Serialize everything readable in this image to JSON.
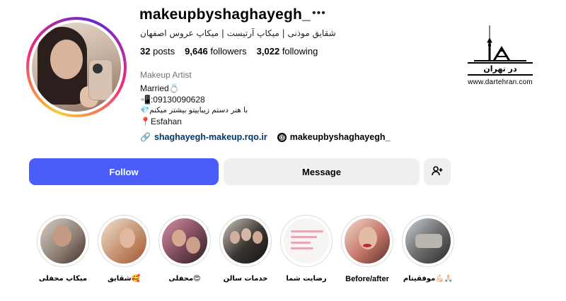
{
  "profile": {
    "username": "makeupbyshaghayegh_",
    "more_icon": "more-horizontal-icon",
    "fullname": "شقایق موذنی | میکاپ آرتیست | میکاپ عروس اصفهان",
    "stats": {
      "posts_count": "32",
      "posts_label": "posts",
      "followers_count": "9,646",
      "followers_label": "followers",
      "following_count": "3,022",
      "following_label": "following"
    },
    "category": "Makeup Artist",
    "bio": {
      "line1": "Married💍",
      "line2": "📲:09130090628",
      "line3": "💎با هنر دستم زیباییتو بیشتر میکنم",
      "line4": "📍Esfahan"
    },
    "link": "shaghayegh-makeup.rqo.ir",
    "threads_handle": "makeupbyshaghayegh_"
  },
  "actions": {
    "follow_label": "Follow",
    "message_label": "Message",
    "add_user_icon": "add-user-icon"
  },
  "watermark": {
    "brand": "در تهران",
    "url": "www.dartehran.com"
  },
  "highlights": [
    {
      "label": "میکاپ محفلی"
    },
    {
      "label": "شقایق🥰"
    },
    {
      "label": "محفلی😍"
    },
    {
      "label": "خدمات سالن"
    },
    {
      "label": "رضایت شما"
    },
    {
      "label": "Before/after"
    },
    {
      "label": "موفقیتام💪🏻🙏🏻"
    }
  ],
  "colors": {
    "follow_button": "#4a5df9",
    "secondary_button": "#efefef",
    "link": "#00376b",
    "muted_text": "#737373"
  }
}
